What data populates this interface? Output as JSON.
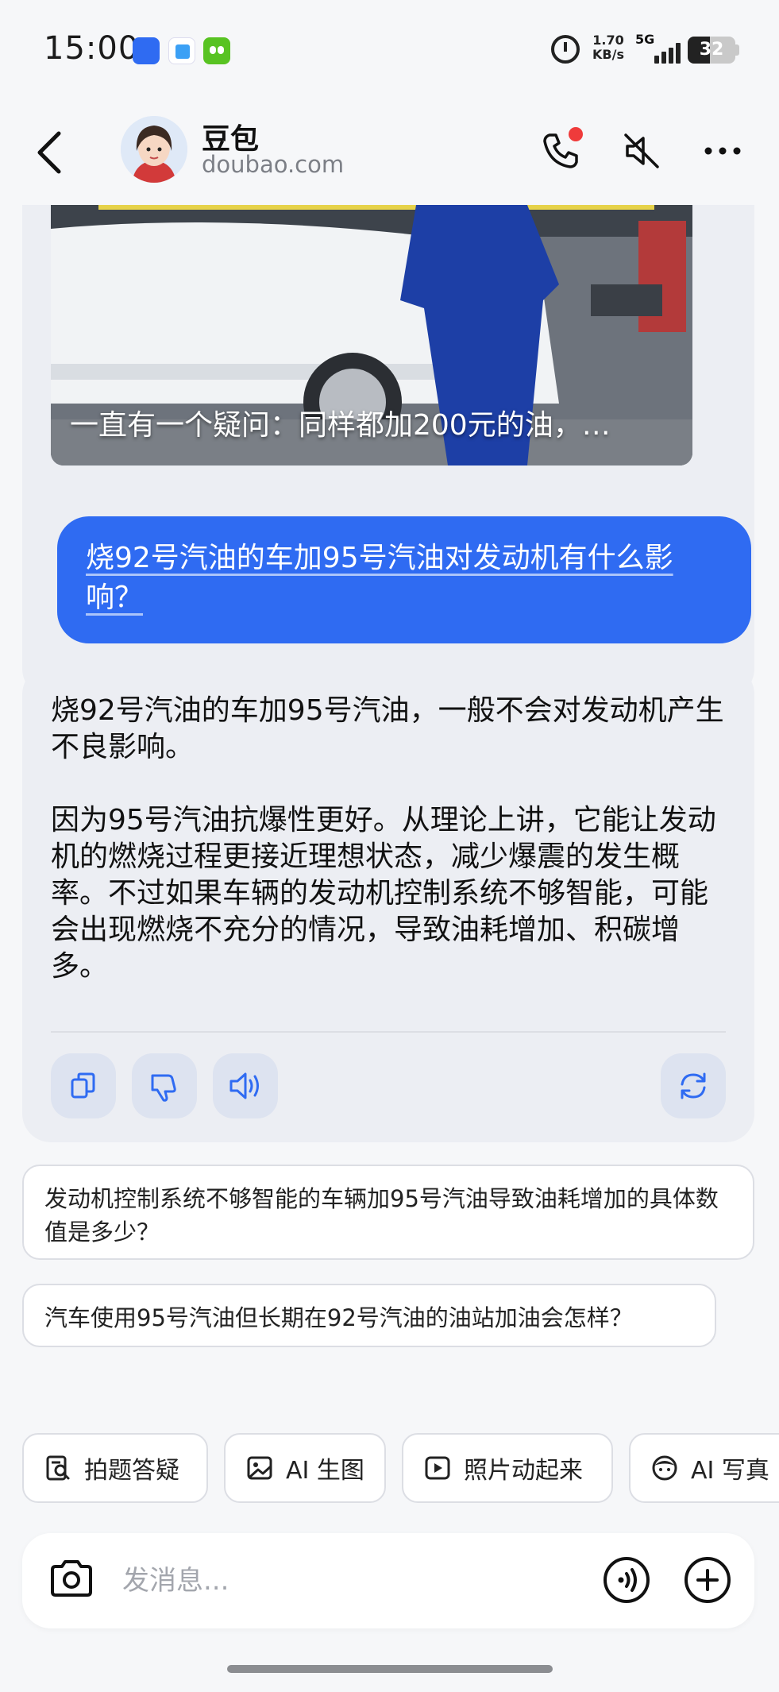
{
  "status_bar": {
    "time": "15:00",
    "net_speed_value": "1.70",
    "net_speed_unit": "KB/s",
    "network_type": "5G",
    "battery_level": "32"
  },
  "header": {
    "title": "豆包",
    "subtitle": "doubao.com",
    "icons": [
      "back-icon",
      "phone-call-icon",
      "mute-speaker-icon",
      "more-icon"
    ]
  },
  "chat": {
    "image_caption": "一直有一个疑问：同样都加200元的油，…",
    "user_message": "烧92号汽油的车加95号汽油对发动机有什么影响？",
    "reply": {
      "paragraph1": "烧92号汽油的车加95号汽油，一般不会对发动机产生不良影响。",
      "paragraph2": "因为95号汽油抗爆性更好。从理论上讲，它能让发动机的燃烧过程更接近理想状态，减少爆震的发生概率。不过如果车辆的发动机控制系统不够智能，可能会出现燃烧不充分的情况，导致油耗增加、积碳增多。",
      "actions": [
        "copy-icon",
        "thumbs-down-icon",
        "speaker-icon",
        "regenerate-icon"
      ]
    },
    "suggestions": [
      "发动机控制系统不够智能的车辆加95号汽油导致油耗增加的具体数值是多少？",
      "汽车使用95号汽油但长期在92号汽油的油站加油会怎样？"
    ]
  },
  "tools": [
    {
      "label": "拍题答疑",
      "icon": "photo-question-icon"
    },
    {
      "label": "AI 生图",
      "icon": "image-icon"
    },
    {
      "label": "照片动起来",
      "icon": "play-icon"
    },
    {
      "label": "AI 写真",
      "icon": "face-icon"
    }
  ],
  "input": {
    "placeholder": "发消息..."
  },
  "colors": {
    "accent": "#2f6bf2",
    "background": "#f6f7f9",
    "card": "#eceef3",
    "notification_dot": "#ef3b3b"
  }
}
